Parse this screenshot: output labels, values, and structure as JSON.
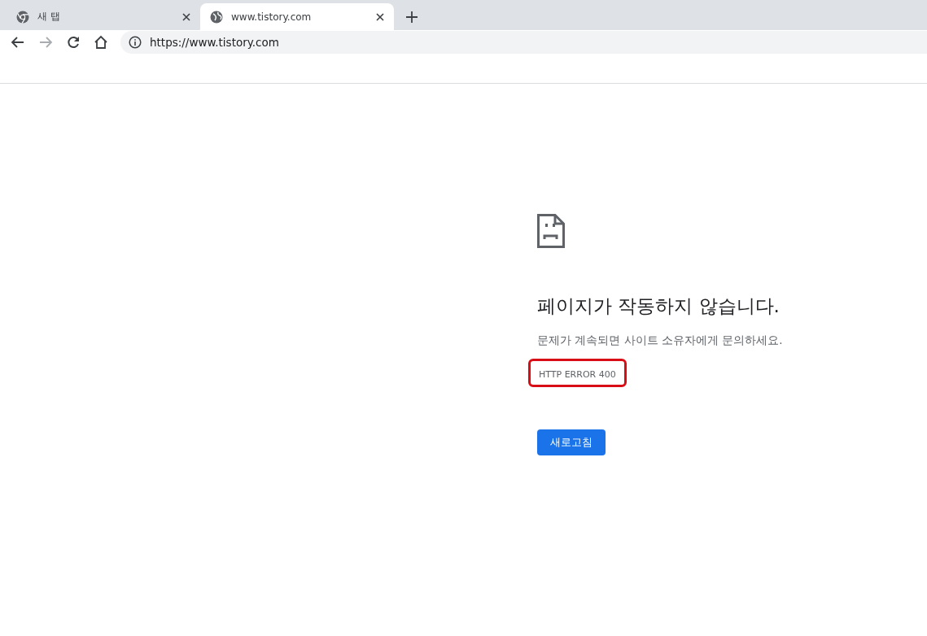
{
  "tabs": [
    {
      "title": "새 탭",
      "kind": "new",
      "selected": false
    },
    {
      "title": "www.tistory.com",
      "kind": "site",
      "selected": true
    }
  ],
  "toolbar": {
    "forward_disabled": true,
    "url": "https://www.tistory.com"
  },
  "error_page": {
    "title": "페이지가 작동하지 않습니다.",
    "message": "문제가 계속되면 사이트 소유자에게 문의하세요.",
    "error_code": "HTTP ERROR 400",
    "error_code_highlighted": true,
    "reload_button": "새로고침"
  }
}
